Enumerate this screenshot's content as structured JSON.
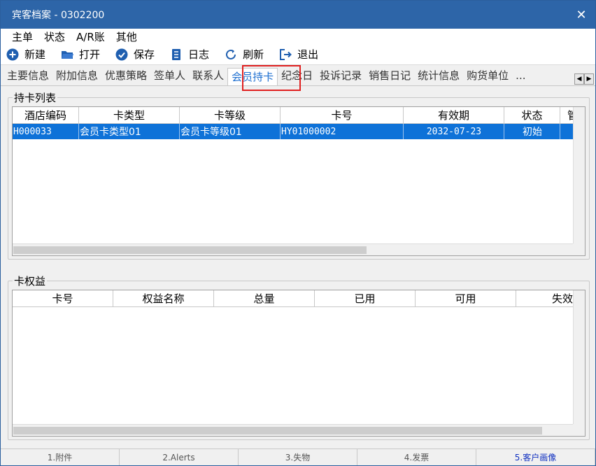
{
  "window": {
    "title": "宾客档案 - 0302200"
  },
  "menu": [
    "主单",
    "状态",
    "A/R账",
    "其他"
  ],
  "toolbar": {
    "new_label": "新建",
    "open_label": "打开",
    "save_label": "保存",
    "log_label": "日志",
    "refresh_label": "刷新",
    "exit_label": "退出"
  },
  "tabs": [
    "主要信息",
    "附加信息",
    "优惠策略",
    "签单人",
    "联系人",
    "会员持卡",
    "纪念日",
    "投诉记录",
    "销售日记",
    "统计信息",
    "购货单位",
    "..."
  ],
  "active_tab": "会员持卡",
  "card_list": {
    "label": "持卡列表",
    "columns": [
      "酒店编码",
      "卡类型",
      "卡等级",
      "卡号",
      "有效期",
      "状态",
      "管"
    ],
    "rows": [
      {
        "hotel_code": "H000033",
        "card_type": "会员卡类型01",
        "card_level": "会员卡等级01",
        "card_no": "HY01000002",
        "expiry": "2032-07-23",
        "status": "初始"
      }
    ]
  },
  "card_benefits": {
    "label": "卡权益",
    "columns": [
      "卡号",
      "权益名称",
      "总量",
      "已用",
      "可用",
      "失效"
    ]
  },
  "statusbar": [
    "1.附件",
    "2.Alerts",
    "3.失物",
    "4.发票",
    "5.客户画像"
  ],
  "colors": {
    "titlebar": "#2d65a8",
    "selected_row": "#0e72d8",
    "accent": "#1e6fd0",
    "highlight": "#e02020"
  }
}
